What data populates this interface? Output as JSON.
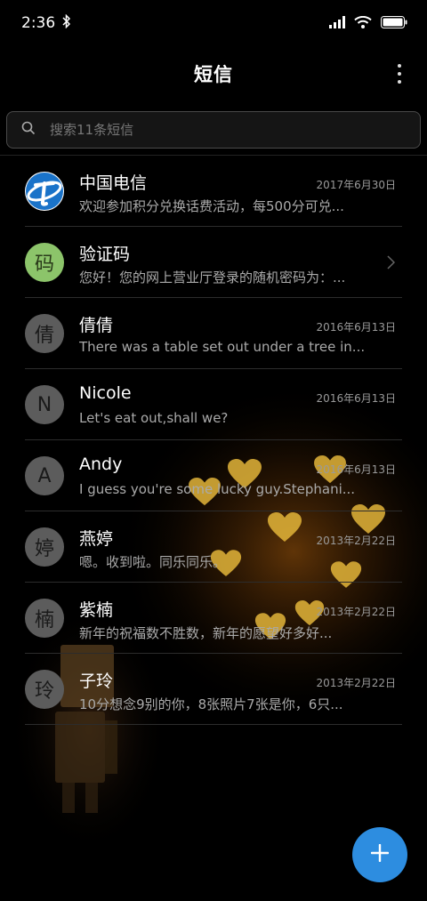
{
  "status_bar": {
    "time": "2:36",
    "icons": [
      "bluetooth-icon",
      "signal-icon",
      "wifi-icon",
      "battery-icon"
    ]
  },
  "header": {
    "title": "短信",
    "more_icon": "more-vertical-icon"
  },
  "search": {
    "icon": "search-icon",
    "placeholder": "搜索11条短信"
  },
  "conversations": [
    {
      "name": "中国电信",
      "date": "2017年6月30日",
      "preview": "欢迎参加积分兑换话费活动，每500分可兑...",
      "avatar": "china-telecom-logo"
    },
    {
      "name": "验证码",
      "date": "",
      "preview": "您好！您的网上营业厅登录的随机密码为：...",
      "avatar_text": "码",
      "avatar_color": "#8cc46a",
      "has_chevron": true
    },
    {
      "name": "倩倩",
      "date": "2016年6月13日",
      "preview": "There was a table set out under a tree in...",
      "avatar_text": "倩"
    },
    {
      "name": "Nicole",
      "date": "2016年6月13日",
      "preview": "Let's eat out,shall we?",
      "avatar_text": "N"
    },
    {
      "name": "Andy",
      "date": "2016年6月13日",
      "preview": "I guess you're some lucky guy.Stephani...",
      "avatar_text": "A"
    },
    {
      "name": "燕婷",
      "date": "2013年2月22日",
      "preview": "嗯。收到啦。同乐同乐。",
      "avatar_text": "婷"
    },
    {
      "name": "紫楠",
      "date": "2013年2月22日",
      "preview": "新年的祝福数不胜数，新年的愿望好多好...",
      "avatar_text": "楠"
    },
    {
      "name": "子玲",
      "date": "2013年2月22日",
      "preview": "10分想念9别的你，8张照片7张是你，6只...",
      "avatar_text": "玲"
    }
  ],
  "fab": {
    "icon": "plus-icon",
    "color": "#2d8de0"
  },
  "theme": {
    "background": "#000000",
    "text_primary": "#ffffff",
    "text_secondary": "#aaaaaa"
  }
}
